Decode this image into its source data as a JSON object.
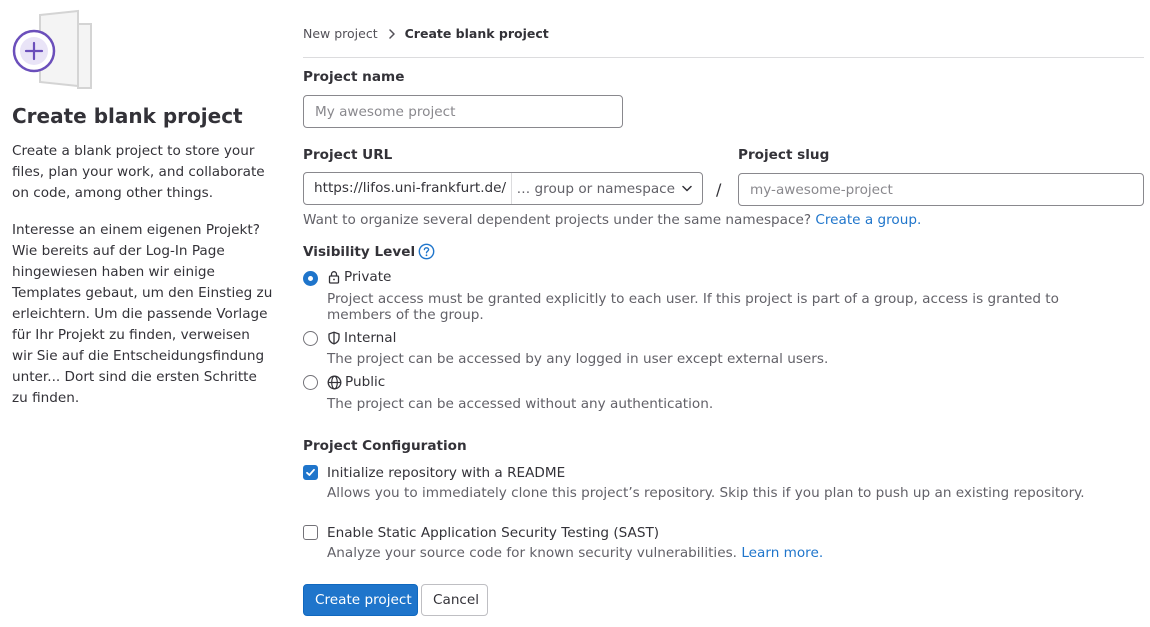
{
  "left": {
    "title": "Create blank project",
    "description": "Create a blank project to store your files, plan your work, and collaborate on code, among other things.",
    "info": "Interesse an einem eigenen Projekt? Wie bereits auf der Log-In Page hingewiesen haben wir einige Templates gebaut, um den Einstieg zu erleichtern. Um die passende Vorlage für Ihr Projekt zu finden, verweisen wir Sie auf die Entscheidungsfindung unter... Dort sind die ersten Schritte zu finden."
  },
  "breadcrumb": {
    "parent": "New project",
    "current": "Create blank project"
  },
  "project_name": {
    "label": "Project name",
    "value": "",
    "placeholder": "My awesome project"
  },
  "project_url": {
    "label": "Project URL",
    "prefix": "https://lifos.uni-frankfurt.de/",
    "namespace_placeholder": "… group or namespace",
    "separator": "/"
  },
  "project_slug": {
    "label": "Project slug",
    "value": "",
    "placeholder": "my-awesome-project"
  },
  "group_help": {
    "text": "Want to organize several dependent projects under the same namespace? ",
    "link": "Create a group."
  },
  "visibility": {
    "label": "Visibility Level",
    "options": [
      {
        "title": "Private",
        "icon": "lock-icon",
        "selected": true,
        "description": "Project access must be granted explicitly to each user. If this project is part of a group, access is granted to members of the group."
      },
      {
        "title": "Internal",
        "icon": "shield-icon",
        "selected": false,
        "description": "The project can be accessed by any logged in user except external users."
      },
      {
        "title": "Public",
        "icon": "globe-icon",
        "selected": false,
        "description": "The project can be accessed without any authentication."
      }
    ]
  },
  "configuration": {
    "label": "Project Configuration",
    "readme": {
      "label": "Initialize repository with a README",
      "checked": true,
      "description": "Allows you to immediately clone this project’s repository. Skip this if you plan to push up an existing repository."
    },
    "sast": {
      "label": "Enable Static Application Security Testing (SAST)",
      "checked": false,
      "description": "Analyze your source code for known security vulnerabilities. ",
      "link": "Learn more."
    }
  },
  "actions": {
    "create": "Create project",
    "cancel": "Cancel"
  },
  "colors": {
    "primary": "#1f75cb",
    "text": "#333238",
    "muted": "#626168",
    "illustration_accent": "#6b4fbb"
  }
}
